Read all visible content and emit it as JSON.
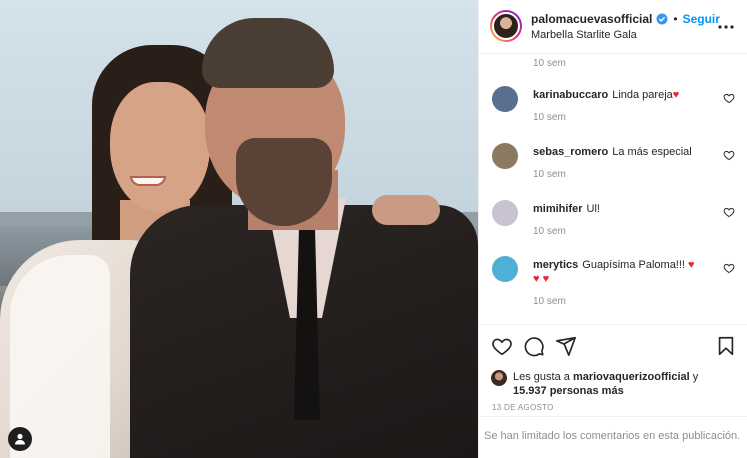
{
  "post": {
    "owner": "palomacuevasofficial",
    "follow_label": "Seguir",
    "location": "Marbella Starlite Gala",
    "date": "13 DE AGOSTO"
  },
  "comments": {
    "top_time": "10 sem",
    "items": [
      {
        "user": "karinabuccaro",
        "text": "Linda pareja",
        "emoji": "♥",
        "time": "10 sem",
        "avatar_color": "#5a6f8f"
      },
      {
        "user": "sebas_romero",
        "text": "La más especial",
        "emoji": "",
        "time": "10 sem",
        "avatar_color": "#8a7a62"
      },
      {
        "user": "mimihifer",
        "text": "Ul!",
        "emoji": "",
        "time": "10 sem",
        "avatar_color": "#c9c2d3"
      },
      {
        "user": "merytics",
        "text": "Guapísima Paloma!!!",
        "emoji": "♥",
        "line2": "♥ ♥",
        "time": "10 sem",
        "avatar_color": "#4fb0d6"
      }
    ]
  },
  "likes": {
    "prefix": "Les gusta a",
    "user": "mariovaquerizoofficial",
    "conj": "y",
    "count": "15.937 personas más"
  },
  "footer": {
    "limited_text": "Se han limitado los comentarios en esta publicación."
  },
  "icons": {
    "verified": "verified-badge-icon",
    "more": "more-options-icon",
    "like": "heart-icon",
    "comment": "comment-icon",
    "share": "share-icon",
    "save": "bookmark-icon",
    "photo_user": "user-tag-icon"
  },
  "colors": {
    "accent": "#0095f6",
    "muted": "#8e8e8e",
    "heart": "#e8233d"
  }
}
